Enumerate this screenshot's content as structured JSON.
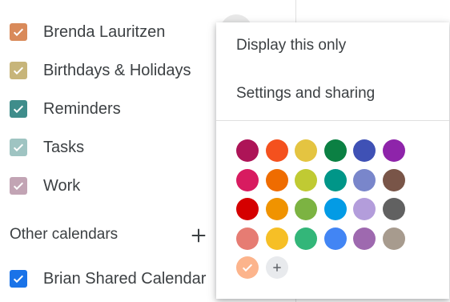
{
  "calendars": [
    {
      "label": "Brenda Lauritzen",
      "color": "#d98a5a",
      "checked": true
    },
    {
      "label": "Birthdays & Holidays",
      "color": "#c7b57a",
      "checked": true
    },
    {
      "label": "Reminders",
      "color": "#3f8d8b",
      "checked": true
    },
    {
      "label": "Tasks",
      "color": "#9fc4c2",
      "checked": true
    },
    {
      "label": "Work",
      "color": "#c2a4b4",
      "checked": true
    }
  ],
  "other_calendars": {
    "title": "Other calendars",
    "add_icon": "plus-icon",
    "items": [
      {
        "label": "Brian Shared Calendar",
        "color": "#1a73e8",
        "checked": true
      }
    ]
  },
  "context_menu": {
    "items": [
      "Display this only",
      "Settings and sharing"
    ],
    "colors": [
      [
        "#ad1457",
        "#f4511e",
        "#e4c441",
        "#0b8043",
        "#3f51b5",
        "#8e24aa"
      ],
      [
        "#d81b60",
        "#ef6c00",
        "#c0ca33",
        "#009688",
        "#7986cb",
        "#795548"
      ],
      [
        "#d50000",
        "#f09300",
        "#7cb342",
        "#039be5",
        "#b39ddb",
        "#616161"
      ],
      [
        "#e67c73",
        "#f6bf26",
        "#33b679",
        "#4285f4",
        "#9e69af",
        "#a79b8e"
      ]
    ],
    "selected_color": "#fcb48c",
    "selected_icon": "check-icon",
    "add_color_icon": "plus-icon"
  }
}
